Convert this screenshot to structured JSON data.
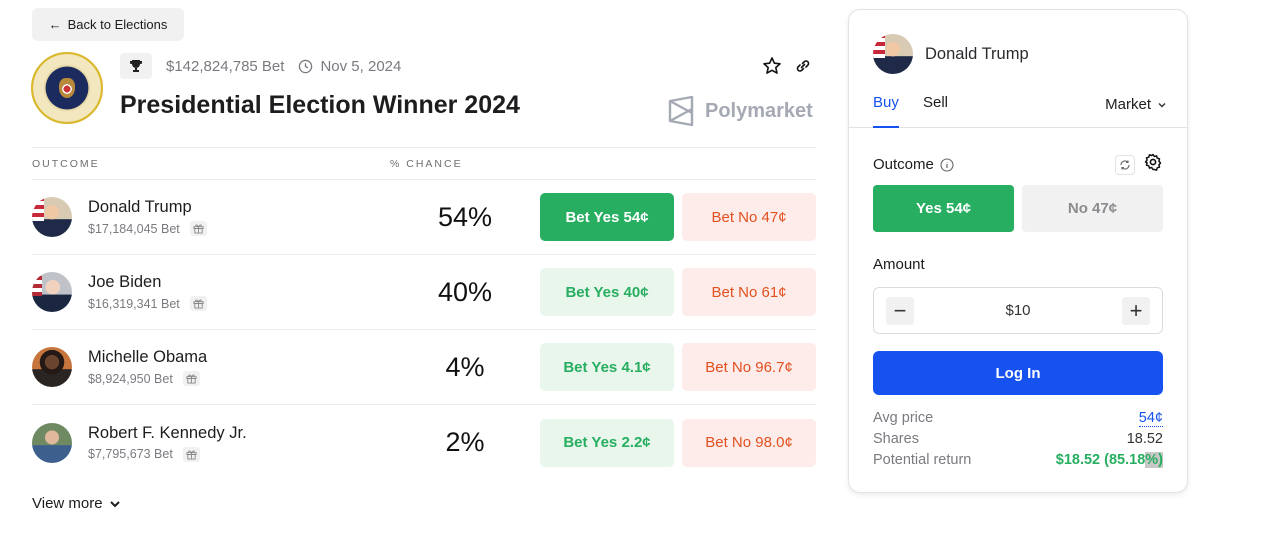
{
  "nav": {
    "back_label": "Back to Elections",
    "back_icon": "arrow-left-icon"
  },
  "event": {
    "volume": "$142,824,785 Bet",
    "date": "Nov 5, 2024",
    "title": "Presidential Election Winner 2024",
    "brand": "Polymarket"
  },
  "table": {
    "headers": {
      "outcome": "OUTCOME",
      "chance": "% CHANCE"
    },
    "rows": [
      {
        "name": "Donald Trump",
        "volume": "$17,184,045 Bet",
        "chance": "54%",
        "yes": "Bet Yes 54¢",
        "no": "Bet No 47¢",
        "selected": true
      },
      {
        "name": "Joe Biden",
        "volume": "$16,319,341 Bet",
        "chance": "40%",
        "yes": "Bet Yes 40¢",
        "no": "Bet No 61¢",
        "selected": false
      },
      {
        "name": "Michelle Obama",
        "volume": "$8,924,950 Bet",
        "chance": "4%",
        "yes": "Bet Yes 4.1¢",
        "no": "Bet No 96.7¢",
        "selected": false
      },
      {
        "name": "Robert F. Kennedy Jr.",
        "volume": "$7,795,673 Bet",
        "chance": "2%",
        "yes": "Bet Yes 2.2¢",
        "no": "Bet No 98.0¢",
        "selected": false
      }
    ],
    "view_more": "View more"
  },
  "panel": {
    "candidate": "Donald Trump",
    "tabs": {
      "buy": "Buy",
      "sell": "Sell"
    },
    "order_type": "Market",
    "outcome_label": "Outcome",
    "yes_option": "Yes 54¢",
    "no_option": "No 47¢",
    "amount_label": "Amount",
    "amount_value": "$10",
    "login": "Log In",
    "stats": {
      "avg_price_label": "Avg price",
      "avg_price": "54¢",
      "shares_label": "Shares",
      "shares": "18.52",
      "return_label": "Potential return",
      "return_main": "$18.52 (85.18",
      "return_tail": "%)"
    }
  },
  "colors": {
    "green": "#27ae60",
    "blue": "#1652f0",
    "red": "#e2501f"
  }
}
